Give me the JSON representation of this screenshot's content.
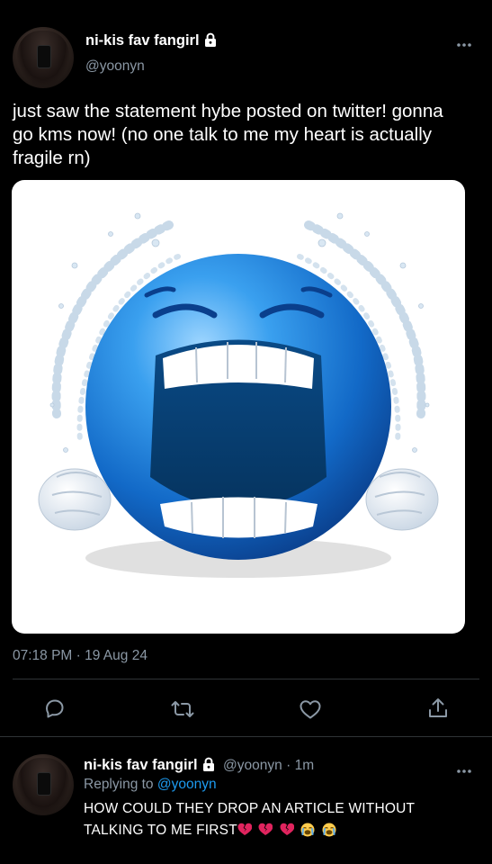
{
  "tweet": {
    "author_name": "ni-kis fav fangirl",
    "author_handle": "@yoonyn",
    "more_icon": "more-dots-icon",
    "text": "just saw the statement hybe posted on twitter! gonna go kms now! (no one talk to me my heart is actually fragile rn)",
    "text_lines": [
      "just saw the statement hybe posted on twitter! gonna",
      "go kms now! (no one talk to me my heart is actually",
      "fragile rn)"
    ],
    "media_icon": "crying-blue-emoji-image",
    "timestamp": "07:18 PM · 19 Aug 24",
    "actions": [
      "reply-icon",
      "retweet-icon",
      "like-icon",
      "share-icon"
    ]
  },
  "reply": {
    "author_name": "ni-kis fav fangirl",
    "author_handle": "@yoonyn",
    "time": "· 1m",
    "replying_prefix": "Replying to",
    "replying_to": "@yoonyn",
    "text_line1": "HOW COULD THEY DROP AN ARTICLE WITHOUT",
    "text_line2": "TALKING TO ME FIRST",
    "emojis": [
      "broken-heart",
      "broken-heart",
      "broken-heart",
      "loudly-crying-face",
      "loudly-crying-face"
    ]
  },
  "colors": {
    "background": "#000000",
    "secondary_text": "#8b98a5",
    "link": "#1d9bf0",
    "divider": "#2f3336",
    "emoji_blue": "#1b7fd6"
  }
}
